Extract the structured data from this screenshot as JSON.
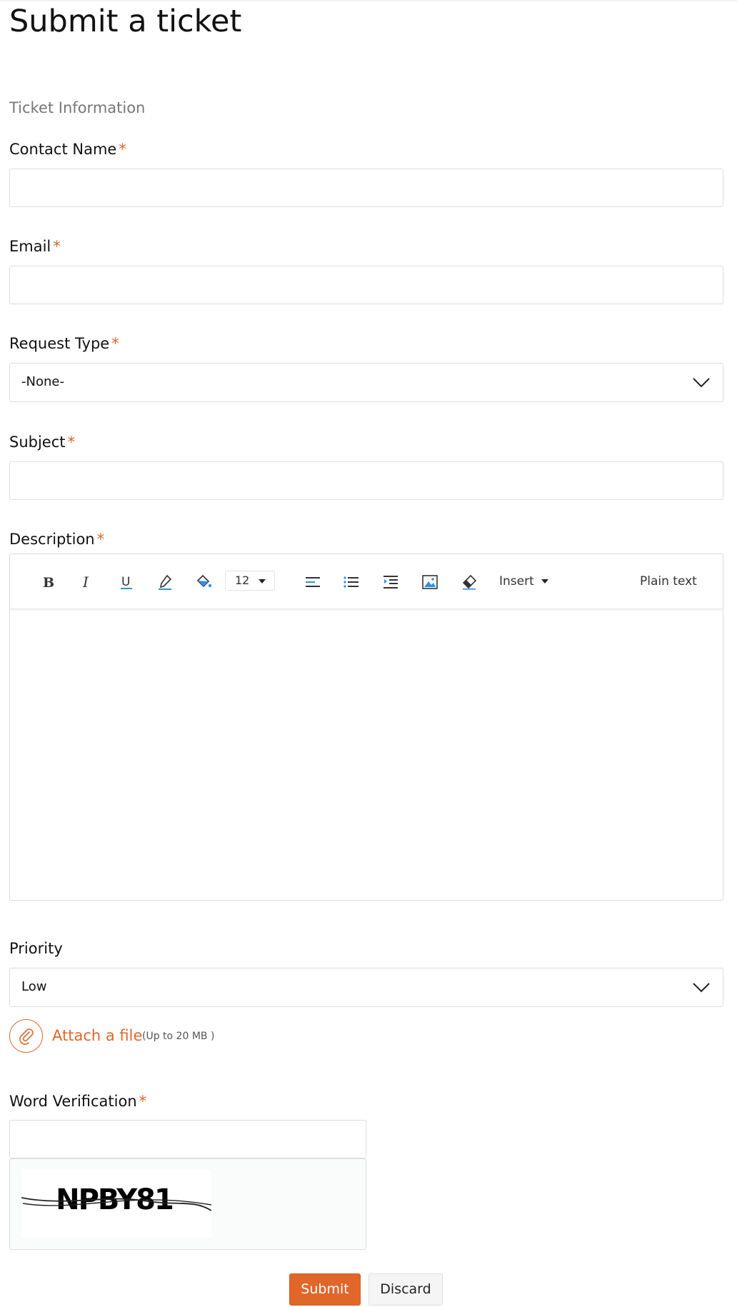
{
  "page": {
    "title": "Submit a ticket",
    "section": "Ticket Information"
  },
  "fields": {
    "contact_name": {
      "label": "Contact Name",
      "required_mark": "*",
      "value": ""
    },
    "email": {
      "label": "Email",
      "required_mark": "*",
      "value": ""
    },
    "request_type": {
      "label": "Request Type",
      "required_mark": "*",
      "value": "-None-"
    },
    "subject": {
      "label": "Subject",
      "required_mark": "*",
      "value": ""
    },
    "description": {
      "label": "Description",
      "required_mark": "*",
      "value": ""
    },
    "priority": {
      "label": "Priority",
      "value": "Low"
    },
    "word_verification": {
      "label": "Word Verification",
      "required_mark": "*",
      "value": "",
      "captcha_text": "NPBY81"
    }
  },
  "toolbar": {
    "font_size": "12",
    "insert_label": "Insert",
    "plain_text_label": "Plain text",
    "icons": [
      "bold-icon",
      "italic-icon",
      "underline-icon",
      "text-color-icon",
      "background-color-icon",
      "align-left-icon",
      "bullet-list-icon",
      "indent-icon",
      "image-icon",
      "eraser-icon"
    ]
  },
  "attachment": {
    "label": "Attach a file",
    "hint": "(Up to 20 MB )"
  },
  "actions": {
    "submit": "Submit",
    "discard": "Discard"
  },
  "colors": {
    "accent": "#e0662a",
    "icon_blue": "#2f8fe0",
    "border": "#dedede"
  }
}
